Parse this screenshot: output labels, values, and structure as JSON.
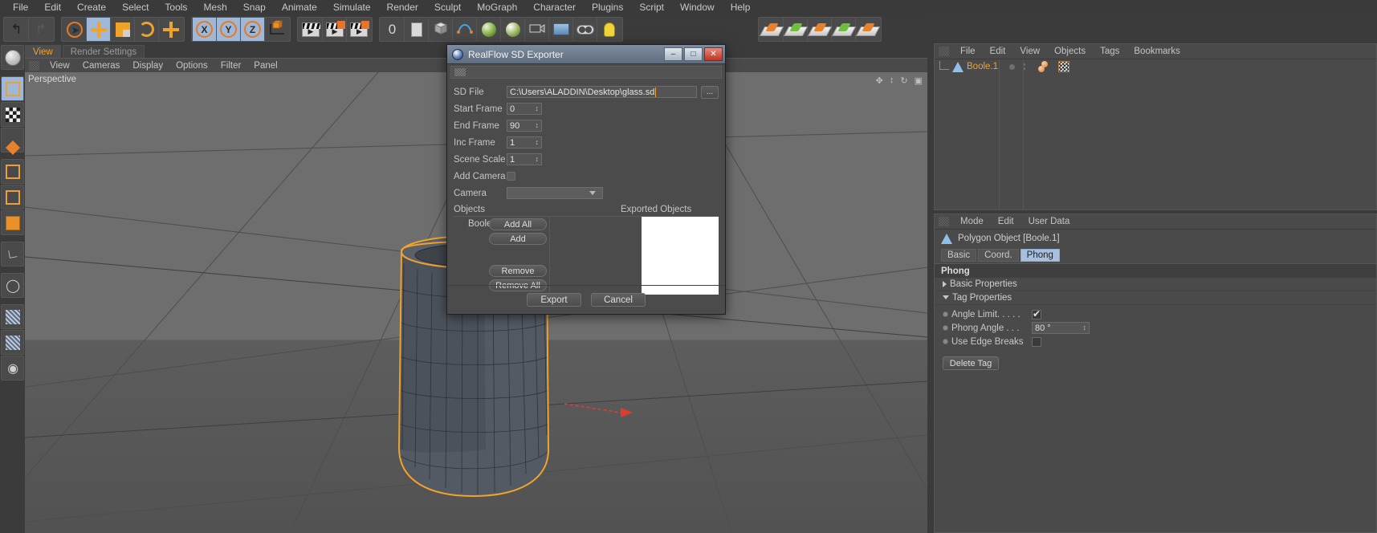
{
  "app": {
    "menubar": [
      "File",
      "Edit",
      "Create",
      "Select",
      "Tools",
      "Mesh",
      "Snap",
      "Animate",
      "Simulate",
      "Render",
      "Sculpt",
      "MoGraph",
      "Character",
      "Plugins",
      "Script",
      "Window",
      "Help"
    ],
    "accent_orange": "#e8a33a",
    "selection_blue": "#9fb8d8",
    "panel_bg": "#4a4a4a",
    "window_bg": "#3b3b3b"
  },
  "toolbar": {
    "axis_labels": [
      "X",
      "Y",
      "Z"
    ],
    "zero_label": "0"
  },
  "viewport": {
    "tabs": [
      {
        "label": "View",
        "active": true
      },
      {
        "label": "Render Settings",
        "active": false
      }
    ],
    "menu": [
      "View",
      "Cameras",
      "Display",
      "Options",
      "Filter",
      "Panel"
    ],
    "camera_label": "Perspective"
  },
  "object_manager": {
    "menu": [
      "File",
      "Edit",
      "View",
      "Objects",
      "Tags",
      "Bookmarks"
    ],
    "items": [
      {
        "name": "Boole.1",
        "type": "polygon-object",
        "selected": true
      }
    ]
  },
  "attribute_manager": {
    "menu": [
      "Mode",
      "Edit",
      "User Data"
    ],
    "object_title": "Polygon Object [Boole.1]",
    "tabs": [
      {
        "label": "Basic",
        "active": false
      },
      {
        "label": "Coord.",
        "active": false
      },
      {
        "label": "Phong",
        "active": true
      }
    ],
    "section_title": "Phong",
    "groups": [
      {
        "label": "Basic Properties",
        "expanded": false
      },
      {
        "label": "Tag Properties",
        "expanded": true
      }
    ],
    "properties": [
      {
        "label": "Angle Limit. . . . .",
        "type": "checkbox",
        "value": "checked"
      },
      {
        "label": "Phong Angle . . .",
        "type": "number",
        "value": "80 °"
      },
      {
        "label": "Use Edge Breaks",
        "type": "checkbox",
        "value": "unchecked"
      }
    ],
    "delete_tag_label": "Delete Tag"
  },
  "dialog": {
    "title": "RealFlow SD Exporter",
    "window_buttons": {
      "minimize": "–",
      "maximize": "□",
      "close": "✕"
    },
    "fields": [
      {
        "label": "SD File",
        "type": "path",
        "value": "C:\\Users\\ALADDIN\\Desktop\\glass.sd",
        "browse_label": "..."
      },
      {
        "label": "Start Frame",
        "type": "number",
        "value": "0"
      },
      {
        "label": "End Frame",
        "type": "number",
        "value": "90"
      },
      {
        "label": "Inc Frame",
        "type": "number",
        "value": "1"
      },
      {
        "label": "Scene Scale",
        "type": "number",
        "value": "1"
      },
      {
        "label": "Add Camera",
        "type": "checkbox",
        "value": "unchecked"
      },
      {
        "label": "Camera",
        "type": "dropdown",
        "value": ""
      }
    ],
    "objects_label": "Objects",
    "exported_objects_label": "Exported Objects",
    "object_items": [
      "Boole.1"
    ],
    "exported_items": [],
    "list_buttons": [
      "Add All",
      "Add",
      "Remove",
      "Remove All"
    ],
    "footer_buttons": [
      "Export",
      "Cancel"
    ]
  }
}
